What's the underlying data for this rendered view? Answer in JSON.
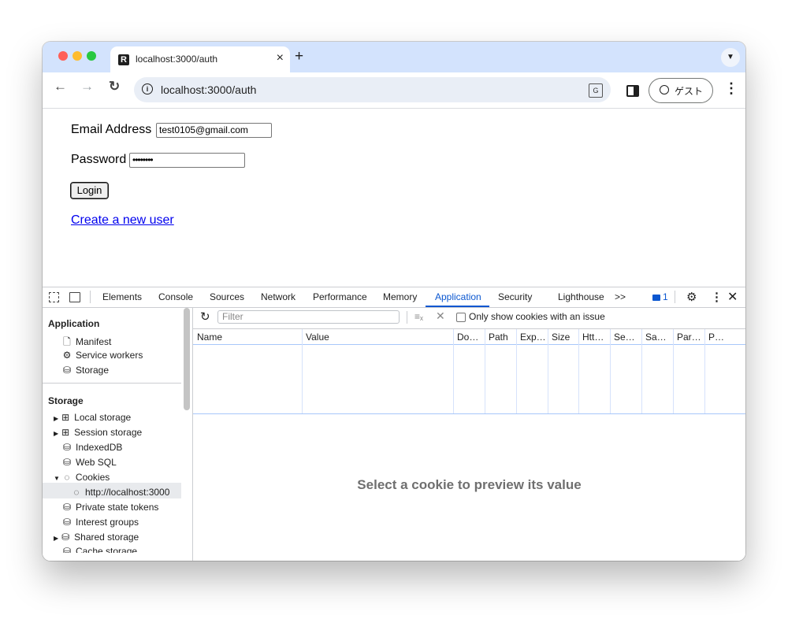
{
  "browser": {
    "tab_title": "localhost:3000/auth",
    "tab_favicon": "R",
    "url": "localhost:3000/auth",
    "profile_label": "ゲスト",
    "window_dots": [
      "#ff5f57",
      "#febc2e",
      "#28c840"
    ]
  },
  "form": {
    "email_label": "Email Address",
    "email_value": "test0105@gmail.com",
    "password_label": "Password",
    "password_value": "••••••••",
    "login_button": "Login",
    "create_user_link": "Create a new user"
  },
  "devtools": {
    "tabs": [
      "Elements",
      "Console",
      "Sources",
      "Network",
      "Performance",
      "Memory",
      "Application",
      "Security",
      "Lighthouse"
    ],
    "active_tab": "Application",
    "more_tabs": ">>",
    "issues_count": "1",
    "sidebar": {
      "application_heading": "Application",
      "application_items": [
        "Manifest",
        "Service workers",
        "Storage"
      ],
      "storage_heading": "Storage",
      "storage_items": [
        "Local storage",
        "Session storage",
        "IndexedDB",
        "Web SQL",
        "Cookies",
        "http://localhost:3000",
        "Private state tokens",
        "Interest groups",
        "Shared storage",
        "Cache storage"
      ]
    },
    "cookies": {
      "filter_placeholder": "Filter",
      "only_issues_label": "Only show cookies with an issue",
      "columns": [
        "Name",
        "Value",
        "Do…",
        "Path",
        "Exp…",
        "Size",
        "Htt…",
        "Se…",
        "Sa…",
        "Par…",
        "P…"
      ],
      "empty_preview": "Select a cookie to preview its value"
    }
  },
  "colors": {
    "accent": "#0b57d0",
    "tabstrip": "#d3e3fd",
    "link": "#0000ee"
  }
}
